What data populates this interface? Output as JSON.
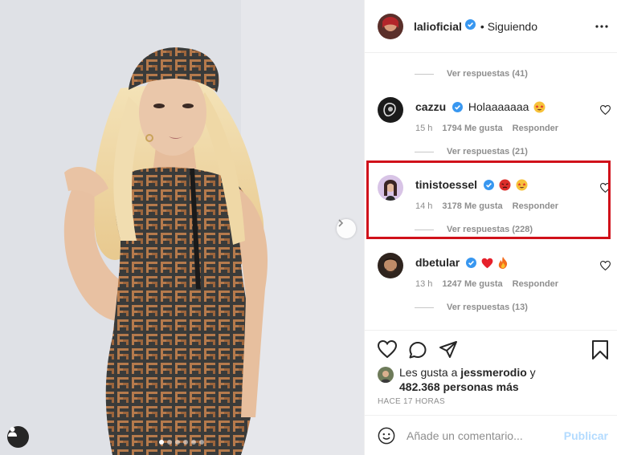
{
  "post": {
    "author": "lalioficial",
    "follow_status": "• Siguiendo",
    "carousel": {
      "count": 6,
      "active_index": 0
    }
  },
  "comments": [
    {
      "replies_label": "Ver respuestas (41)"
    },
    {
      "user": "cazzu",
      "text": "Holaaaaaaa",
      "emojis": [
        "star-struck"
      ],
      "time": "15 h",
      "likes": "1794 Me gusta",
      "reply": "Responder",
      "replies_label": "Ver respuestas (21)"
    },
    {
      "user": "tinistoessel",
      "text": "",
      "emojis": [
        "red-face",
        "star-struck"
      ],
      "time": "14 h",
      "likes": "3178 Me gusta",
      "reply": "Responder",
      "replies_label": "Ver respuestas (228)"
    },
    {
      "user": "dbetular",
      "text": "",
      "emojis": [
        "red-heart",
        "fire"
      ],
      "time": "13 h",
      "likes": "1247 Me gusta",
      "reply": "Responder",
      "replies_label": "Ver respuestas (13)"
    }
  ],
  "likes": {
    "prefix": "Les gusta a",
    "user": "jessmerodio",
    "connector": "y",
    "others": "482.368 personas más"
  },
  "timestamp": "HACE 17 HORAS",
  "composer": {
    "placeholder": "Añade un comentario...",
    "publish_label": "Publicar"
  },
  "colors": {
    "verified": "#3897f0",
    "highlight": "#d0111a",
    "meta_gray": "#8e8e8e",
    "publish_disabled": "#b3dbff"
  }
}
